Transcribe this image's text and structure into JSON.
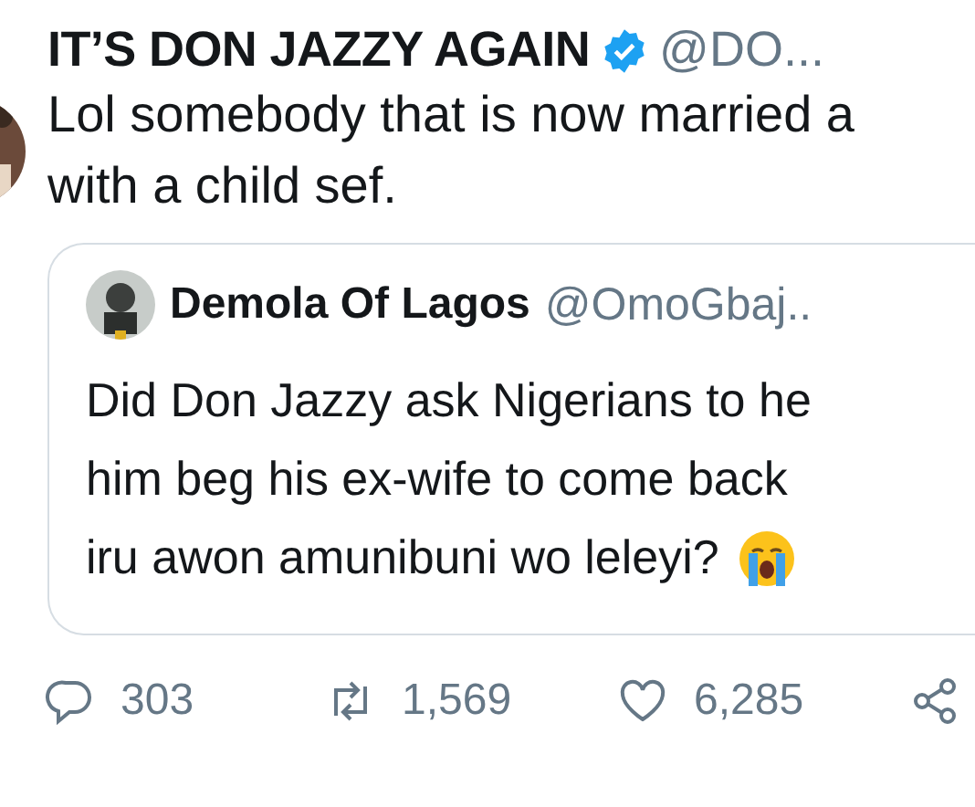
{
  "tweet": {
    "author": {
      "name": "IT’S DON JAZZY AGAIN",
      "verified": true,
      "handle": "@DO..."
    },
    "text_lines": [
      "Lol somebody that is now married a",
      "with a child sef."
    ],
    "quoted_tweet": {
      "author": {
        "name": "Demola Of Lagos",
        "handle": "@OmoGbaj.."
      },
      "text_lines": [
        "Did Don Jazzy ask Nigerians to he",
        "him beg his ex-wife to come back",
        "iru awon amunibuni wo leleyi?"
      ],
      "ends_with_emoji": true
    },
    "actions": [
      {
        "kind": "reply",
        "count": "303"
      },
      {
        "kind": "retweet",
        "count": "1,569"
      },
      {
        "kind": "like",
        "count": "6,285"
      },
      {
        "kind": "share"
      }
    ]
  }
}
